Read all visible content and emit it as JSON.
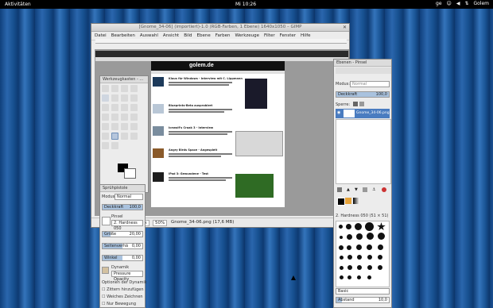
{
  "topbar": {
    "activities": "Aktivitäten",
    "clock": "Mi 10:26",
    "keyboard": "ge",
    "user": "Golem"
  },
  "gimp_main": {
    "title": "[Gnome_34-06] (importiert)-1.0 (RGB-Farben, 1 Ebene) 1640x1050 – GIMP",
    "menu": [
      "Datei",
      "Bearbeiten",
      "Auswahl",
      "Ansicht",
      "Bild",
      "Ebene",
      "Farben",
      "Werkzeuge",
      "Filter",
      "Fenster",
      "Hilfe"
    ],
    "zoom": "50%",
    "unit": "px",
    "status": "Gnome_34-06.png (17,6 MB)"
  },
  "webpage": {
    "logo": "golem.de",
    "headlines": [
      "Klaus für Windows - Interview mit C. Lippmann",
      "Blueprints-Beta ausprobiert",
      "Icewolf's Croak 3 - Interview",
      "Angry Birds Space - Angespielt",
      "iPad 3: Gewundene - Test"
    ]
  },
  "toolbox": {
    "title": "Werkzeugkasten - ...",
    "options_title": "Sprühpistole",
    "mode_label": "Modus:",
    "mode_value": "Normal",
    "opacity_label": "Deckkraft",
    "opacity_value": "100,0",
    "brush_label": "Pinsel",
    "brush_value": "2. Hardness 050",
    "size_label": "Größe",
    "size_value": "20,00",
    "aspect_label": "Seitenverhä",
    "aspect_value": "0,00",
    "angle_label": "Winkel",
    "angle_value": "0,00",
    "dynamics_label": "Dynamik",
    "dynamics_value": "Pressure Opacity",
    "dynamics_options": "Optionen der Dynamik",
    "checkboxes": [
      "Zittern hinzufügen",
      "Weiches Zeichnen",
      "Nur Bewegung"
    ]
  },
  "layers": {
    "title": "Ebenen - Pinsel",
    "mode_label": "Modus:",
    "mode_value": "Normal",
    "opacity_label": "Deckkraft",
    "opacity_value": "100,0",
    "lock_label": "Sperre:",
    "layer_name": "Gnome_34-06.png",
    "brush_name": "2. Hardness 050 (51 × 51)",
    "brush_tag": "Basic",
    "spacing_label": "Abstand",
    "spacing_value": "10,0"
  },
  "colors": {
    "fg": "#000000",
    "bg": "#ffffff",
    "selection": "#4a7cc0"
  }
}
